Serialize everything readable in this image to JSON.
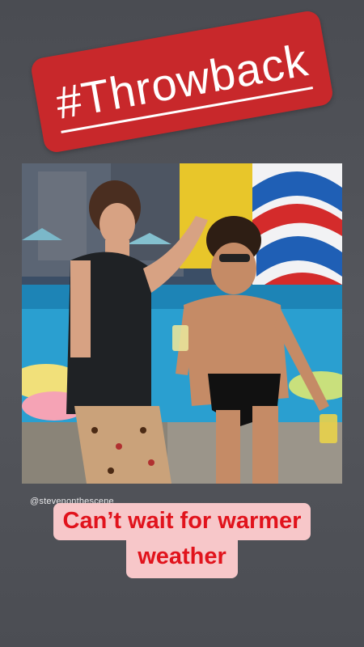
{
  "sticker": {
    "text": "#Throwback",
    "color": "#c8282b"
  },
  "photo": {
    "description_icon": "photo-image"
  },
  "credit": {
    "handle": "@stevenonthescene"
  },
  "caption": {
    "line1": "Can’t wait for warmer",
    "line2": "weather",
    "text_color": "#e1131c",
    "background_color": "#f7c7c9"
  }
}
